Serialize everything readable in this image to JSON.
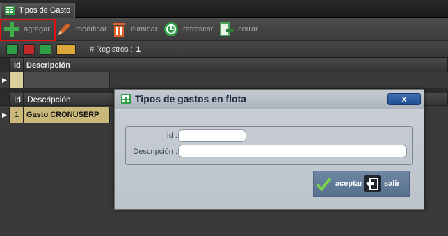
{
  "window": {
    "tab_title": "Tipos de Gasto"
  },
  "toolbar": {
    "agregar": "agregar",
    "modificar": "modificar",
    "eliminar": "eliminar",
    "refrescar": "refrescar",
    "cerrar": "cerrar"
  },
  "subbar": {
    "registros_label": "# Registros :",
    "registros_count": "1"
  },
  "grid_top": {
    "columns": [
      "Id",
      "Descripción"
    ],
    "rows": [
      {
        "id": "",
        "descripcion": ""
      }
    ]
  },
  "grid_main": {
    "columns": [
      "Id",
      "Descripción"
    ],
    "rows": [
      {
        "id": "1",
        "descripcion": "Gasto CRONUSERP"
      }
    ]
  },
  "modal": {
    "title": "Tipos de gastos en flota",
    "close_label": "x",
    "id_label": "Id :",
    "id_value": "",
    "descripcion_label": "Descripción :",
    "descripcion_value": "",
    "aceptar": "aceptar",
    "salir": "salir"
  },
  "colors": {
    "highlight": "#e31010",
    "add_green": "#3fae49",
    "edit_orange": "#d9642a",
    "delete_orange": "#e0622b",
    "refresh_green": "#2f9e44",
    "close_green": "#4da35a",
    "modal_header": "#aab3bd",
    "action_bar": "#5f7896",
    "selected_row": "#c9b87a"
  },
  "icons": {
    "tab": "grid-icon",
    "agregar": "plus-icon",
    "modificar": "pencil-icon",
    "eliminar": "trash-icon",
    "refrescar": "refresh-icon",
    "cerrar": "document-exit-icon",
    "aceptar": "checkmark-icon",
    "salir": "exit-door-icon"
  }
}
